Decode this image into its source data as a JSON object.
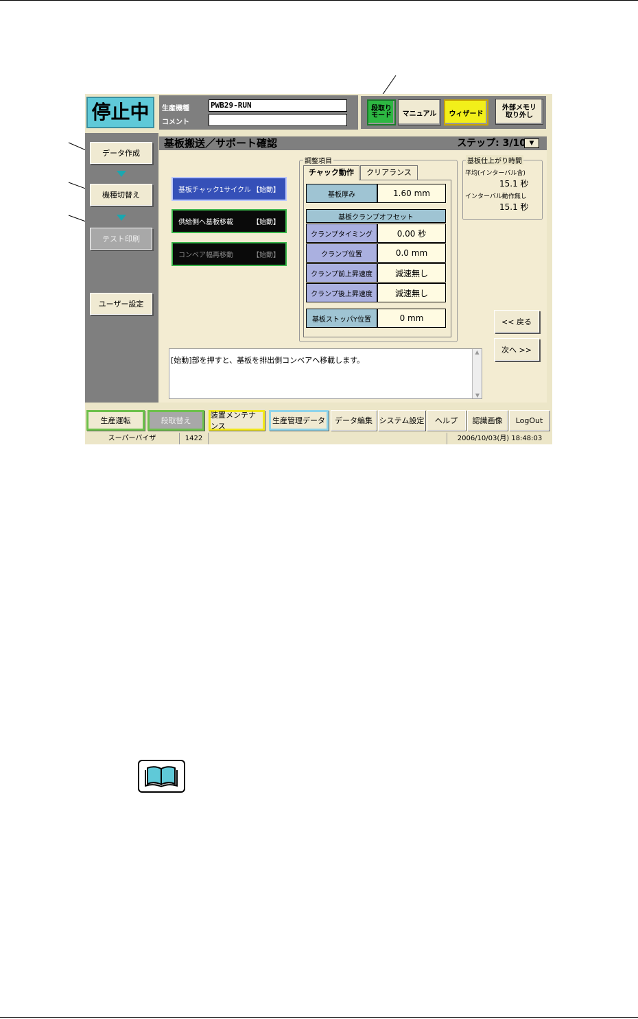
{
  "status": "停止中",
  "header": {
    "model_label": "生産機種",
    "model_value": "PWB29-RUN",
    "comment_label": "コメント",
    "comment_value": ""
  },
  "modes": {
    "setup_mode": "段取り\nモード",
    "manual": "マニュアル",
    "wizard": "ウィザード",
    "external_memory": "外部メモリ\n取り外し"
  },
  "title": "基板搬送／サポート確認",
  "step": "ステップ: 3/10",
  "sidebar": {
    "items": [
      {
        "label": "データ作成"
      },
      {
        "label": "機種切替え"
      },
      {
        "label": "テスト印刷"
      },
      {
        "label": "ユーザー設定"
      }
    ]
  },
  "actions": [
    {
      "label": "基板チャック1サイクル",
      "start": "【始動】"
    },
    {
      "label": "供給側へ基板移載",
      "start": "【始動】"
    },
    {
      "label": "コンベア幅再移動",
      "start": "【始動】"
    }
  ],
  "adjust": {
    "group_label": "調整項目",
    "tabs": [
      "チャック動作",
      "クリアランス"
    ],
    "board_thickness_label": "基板厚み",
    "board_thickness_value": "1.60 mm",
    "clamp_offset_header": "基板クランプオフセット",
    "rows": [
      {
        "label": "クランプタイミング",
        "value": "0.00 秒"
      },
      {
        "label": "クランプ位置",
        "value": "0.0 mm"
      },
      {
        "label": "クランプ前上昇速度",
        "value": "減速無し"
      },
      {
        "label": "クランプ後上昇速度",
        "value": "減速無し"
      }
    ],
    "stopper_label": "基板ストッパY位置",
    "stopper_value": "0 mm"
  },
  "finish_time": {
    "group_label": "基板仕上がり時間",
    "avg_label": "平均(インターバル含)",
    "avg_value": "15.1 秒",
    "interval_label": "インターバル動作無し",
    "interval_value": "15.1 秒"
  },
  "nav": {
    "back": "<< 戻る",
    "next": "次へ >>"
  },
  "message": "[始動]部を押すと、基板を排出側コンベアへ移載します。",
  "bottom": [
    "生産運転",
    "段取替え",
    "装置メンテナンス",
    "生産管理データ",
    "データ編集",
    "システム設定",
    "ヘルプ",
    "認識画像",
    "LogOut"
  ],
  "statusbar": {
    "user": "スーパーバイザ",
    "code": "1422",
    "datetime": "2006/10/03(月) 18:48:03"
  },
  "icons": {
    "manual_icon": "book-icon"
  }
}
